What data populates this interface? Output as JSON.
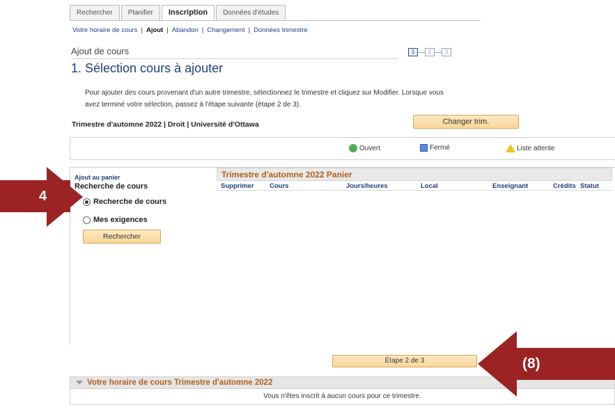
{
  "tabs": [
    {
      "label": "Rechercher"
    },
    {
      "label": "Planifier"
    },
    {
      "label": "Inscription"
    },
    {
      "label": "Données d'études"
    }
  ],
  "subnav": [
    {
      "label": "Votre horaire de cours"
    },
    {
      "label": "Ajout"
    },
    {
      "label": "Abandon"
    },
    {
      "label": "Changement"
    },
    {
      "label": "Données trimestre"
    }
  ],
  "section_title": "Ajout de cours",
  "page_title": "1. Sélection cours à ajouter",
  "steps": [
    "1",
    "2",
    "3"
  ],
  "instructions": "Pour ajouter des cours provenant d'un autre trimestre, sélectionnez le trimestre et cliquez sur Modifier. Lorsque vous avez terminé votre sélection, passez à l'étape suivante (étape 2 de 3).",
  "term_label": "Trimestre d'automne 2022 | Droit | Université d'Ottawa",
  "change_term_button": "Changer trim.",
  "legend": {
    "open": "Ouvert",
    "closed": "Fermé",
    "waitlist": "Liste attente",
    "colors": {
      "open": "#4caf50",
      "closed": "#5b8be0",
      "waitlist": "#f2c218"
    }
  },
  "left_panel": {
    "add_to_cart": "Ajout au panier",
    "search_heading": "Recherche de cours",
    "radio_search": "Recherche de cours",
    "radio_requirements": "Mes exigences",
    "search_button": "Rechercher"
  },
  "cart": {
    "title": "Trimestre d'automne 2022 Panier",
    "columns": [
      "Supprimer",
      "Cours",
      "Jours/heures",
      "Local",
      "Enseignant",
      "Crédits",
      "Statut"
    ]
  },
  "next_step_button": "Étape 2 de 3",
  "schedule": {
    "title": "Votre horaire de cours Trimestre d'automne 2022",
    "empty_message": "Vous n'êtes inscrit à aucun cours pour ce trimestre."
  },
  "annotations": {
    "label_a": "4",
    "label_b": "(8)",
    "color": "#9b2323"
  }
}
